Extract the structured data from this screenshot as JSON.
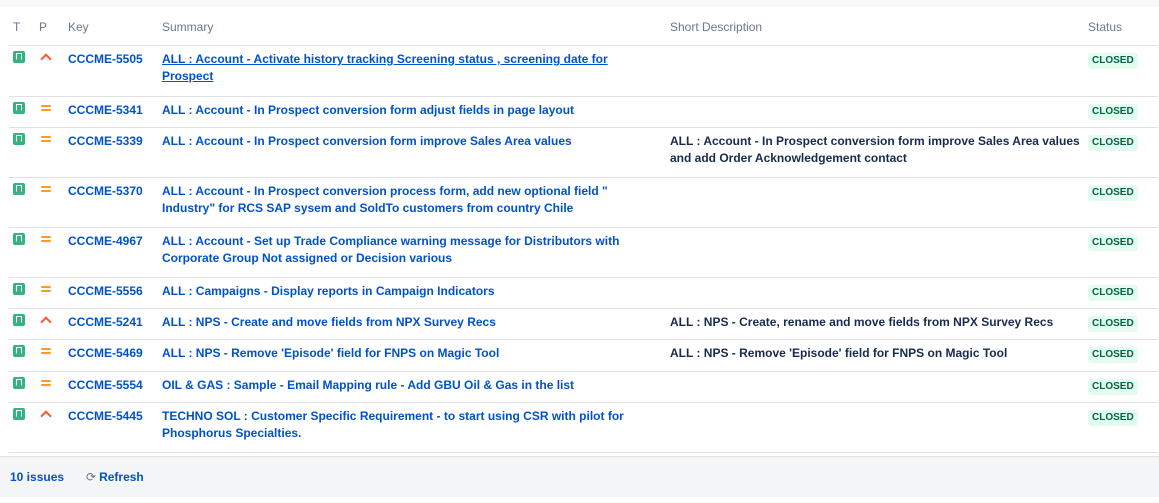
{
  "columns": {
    "type": "T",
    "priority": "P",
    "key": "Key",
    "summary": "Summary",
    "short_description": "Short Description",
    "status": "Status"
  },
  "rows": [
    {
      "type_icon": "story-icon",
      "priority_icon": "priority-high-icon",
      "key": "CCCME-5505",
      "summary": "ALL : Account - Activate history tracking Screening status , screening date for Prospect",
      "short_description": "",
      "status": "CLOSED"
    },
    {
      "type_icon": "story-icon",
      "priority_icon": "priority-major-icon",
      "key": "CCCME-5341",
      "summary": "ALL : Account - In Prospect conversion form adjust fields in page layout",
      "short_description": "",
      "status": "CLOSED"
    },
    {
      "type_icon": "story-icon",
      "priority_icon": "priority-major-icon",
      "key": "CCCME-5339",
      "summary": "ALL : Account - In Prospect conversion form improve Sales Area values",
      "short_description": "ALL : Account - In Prospect conversion form improve Sales Area values and add Order Acknowledgement contact",
      "status": "CLOSED"
    },
    {
      "type_icon": "story-icon",
      "priority_icon": "priority-major-icon",
      "key": "CCCME-5370",
      "summary": "ALL : Account - In Prospect conversion process form, add new optional field \" Industry\" for RCS SAP sysem and SoldTo customers from country Chile",
      "short_description": "",
      "status": "CLOSED"
    },
    {
      "type_icon": "story-icon",
      "priority_icon": "priority-major-icon",
      "key": "CCCME-4967",
      "summary": "ALL : Account - Set up Trade Compliance warning message for Distributors with Corporate Group Not assigned or Decision various",
      "short_description": "",
      "status": "CLOSED"
    },
    {
      "type_icon": "story-icon",
      "priority_icon": "priority-major-icon",
      "key": "CCCME-5556",
      "summary": "ALL : Campaigns - Display reports in Campaign Indicators",
      "short_description": "",
      "status": "CLOSED"
    },
    {
      "type_icon": "story-icon",
      "priority_icon": "priority-high-icon",
      "key": "CCCME-5241",
      "summary": "ALL : NPS - Create and move fields from NPX Survey Recs",
      "short_description": "ALL : NPS - Create, rename and move fields from NPX Survey Recs",
      "status": "CLOSED"
    },
    {
      "type_icon": "story-icon",
      "priority_icon": "priority-major-icon",
      "key": "CCCME-5469",
      "summary": "ALL : NPS - Remove 'Episode' field for FNPS on Magic Tool",
      "short_description": "ALL : NPS - Remove 'Episode' field for FNPS on Magic Tool",
      "status": "CLOSED"
    },
    {
      "type_icon": "story-icon",
      "priority_icon": "priority-major-icon",
      "key": "CCCME-5554",
      "summary": "OIL & GAS : Sample - Email Mapping rule - Add GBU Oil & Gas in the list",
      "short_description": "",
      "status": "CLOSED"
    },
    {
      "type_icon": "story-icon",
      "priority_icon": "priority-high-icon",
      "key": "CCCME-5445",
      "summary": "TECHNO SOL : Customer Specific Requirement - to start using CSR with pilot for Phosphorus Specialties.",
      "short_description": "",
      "status": "CLOSED"
    }
  ],
  "footer": {
    "issue_count": "10 issues",
    "refresh_label": "Refresh"
  },
  "colors": {
    "link": "#0052cc",
    "story": "#36b37e",
    "priority_major": "#ff991f",
    "priority_high": "#ff5630",
    "status_bg": "#e3fcef",
    "status_text": "#006644"
  }
}
